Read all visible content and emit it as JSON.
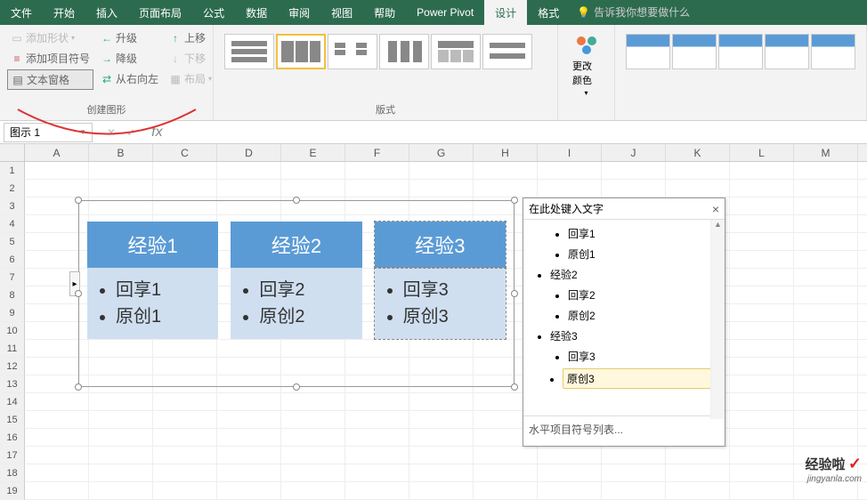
{
  "menu": {
    "tabs": [
      "文件",
      "开始",
      "插入",
      "页面布局",
      "公式",
      "数据",
      "审阅",
      "视图",
      "帮助",
      "Power Pivot",
      "设计",
      "格式"
    ],
    "active": "设计",
    "search_placeholder": "告诉我你想要做什么"
  },
  "ribbon": {
    "group1": {
      "label": "创建图形",
      "add_shape": "添加形状",
      "add_bullet": "添加项目符号",
      "text_pane": "文本窗格",
      "promote": "升级",
      "demote": "降级",
      "rtl": "从右向左",
      "move_up": "上移",
      "move_down": "下移",
      "layout": "布局"
    },
    "group2": {
      "label": "版式"
    },
    "group3": {
      "change_colors": "更改颜色"
    }
  },
  "namebox": "图示 1",
  "columns": [
    "A",
    "B",
    "C",
    "D",
    "E",
    "F",
    "G",
    "H",
    "I",
    "J",
    "K",
    "L",
    "M"
  ],
  "rows": [
    "1",
    "2",
    "3",
    "4",
    "5",
    "6",
    "7",
    "8",
    "9",
    "10",
    "11",
    "12",
    "13",
    "14",
    "15",
    "16",
    "17",
    "18",
    "19"
  ],
  "smartart": {
    "cards": [
      {
        "title": "经验1",
        "items": [
          "回享1",
          "原创1"
        ]
      },
      {
        "title": "经验2",
        "items": [
          "回享2",
          "原创2"
        ]
      },
      {
        "title": "经验3",
        "items": [
          "回享3",
          "原创3"
        ]
      }
    ]
  },
  "textpane": {
    "title": "在此处键入文字",
    "items": [
      {
        "level": 2,
        "text": "回享1"
      },
      {
        "level": 2,
        "text": "原创1"
      },
      {
        "level": 1,
        "text": "经验2"
      },
      {
        "level": 2,
        "text": "回享2"
      },
      {
        "level": 2,
        "text": "原创2"
      },
      {
        "level": 1,
        "text": "经验3"
      },
      {
        "level": 2,
        "text": "回享3"
      },
      {
        "level": 2,
        "text": "原创3",
        "selected": true
      }
    ],
    "footer": "水平项目符号列表..."
  },
  "watermark": {
    "brand": "经验啦",
    "url": "jingyanla.com"
  }
}
